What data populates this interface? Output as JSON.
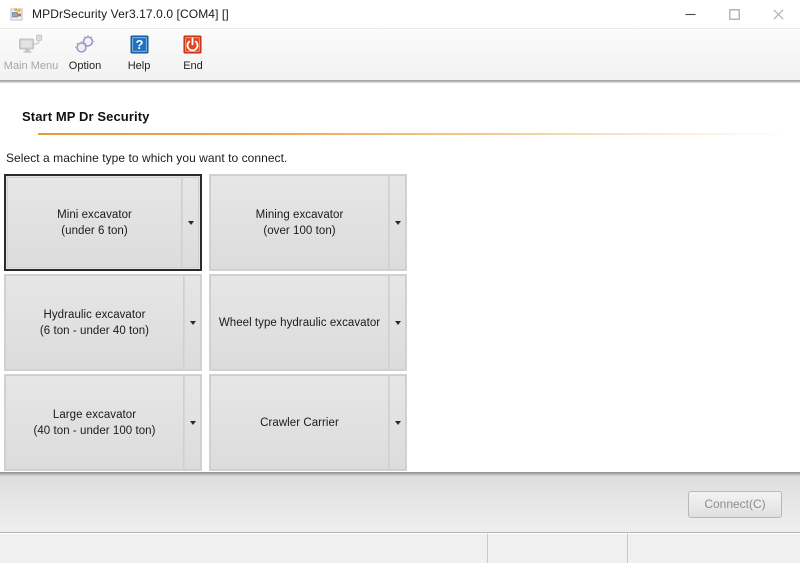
{
  "window": {
    "title": "MPDrSecurity Ver3.17.0.0 [COM4] []",
    "app_icon": "app-icon",
    "controls": {
      "minimize": "minimize-icon",
      "maximize": "maximize-icon",
      "close": "close-icon"
    }
  },
  "toolbar": {
    "items": [
      {
        "label": "Main Menu",
        "icon": "monitor-icon",
        "disabled": true
      },
      {
        "label": "Option",
        "icon": "gears-icon",
        "disabled": false
      },
      {
        "label": "Help",
        "icon": "question-mark-icon",
        "disabled": false
      },
      {
        "label": "End",
        "icon": "power-icon",
        "disabled": false
      }
    ]
  },
  "main": {
    "page_title": "Start MP Dr Security",
    "instruction": "Select a machine type to which you want to connect.",
    "machines": [
      {
        "label": "Mini excavator\n(under 6 ton)",
        "focused": true
      },
      {
        "label": "Mining excavator\n(over 100 ton)",
        "focused": false
      },
      {
        "label": "Hydraulic excavator\n(6 ton - under 40 ton)",
        "focused": false
      },
      {
        "label": "Wheel type hydraulic excavator",
        "focused": false
      },
      {
        "label": "Large excavator\n(40 ton - under 100 ton)",
        "focused": false
      },
      {
        "label": "Crawler Carrier",
        "focused": false
      }
    ]
  },
  "actions": {
    "connect_label": "Connect(C)",
    "connect_disabled": true
  },
  "statusbar": {
    "cells": [
      "",
      "",
      ""
    ]
  },
  "colors": {
    "accent_rule": "#e79a3c",
    "help_icon": "#1f72bf",
    "end_icon": "#df4521",
    "option_icon": "#9a8fc4",
    "focus_border": "#2b2b2b"
  }
}
